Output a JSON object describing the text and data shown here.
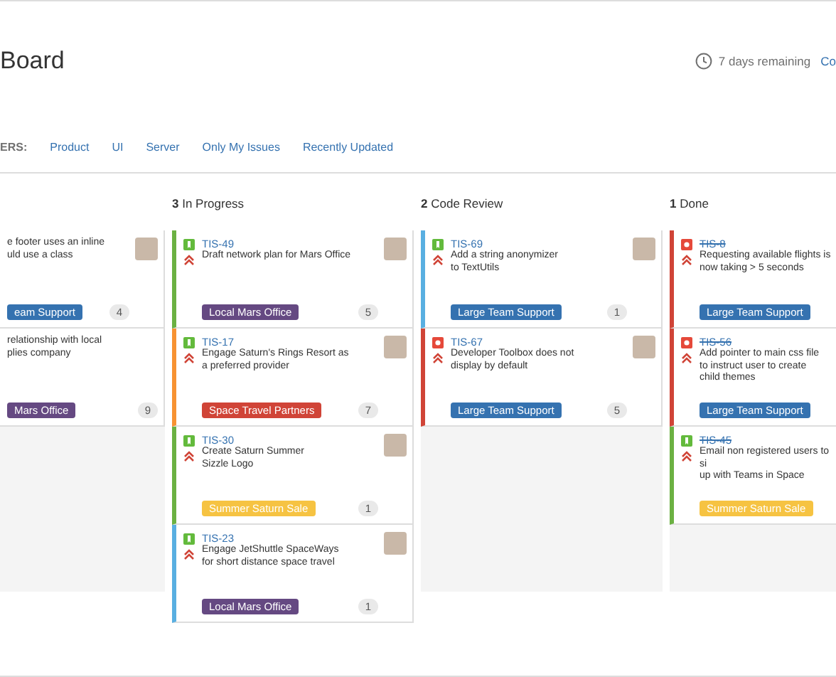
{
  "header": {
    "title": "Board",
    "remaining": "7 days remaining",
    "link": "Co"
  },
  "filters": {
    "label": "ERS:",
    "items": [
      "Product",
      "UI",
      "Server",
      "Only My Issues",
      "Recently Updated"
    ]
  },
  "columns": [
    {
      "cards": [
        {
          "summary": "e footer uses an inline\nuld use a class",
          "epic": {
            "label": "eam Support",
            "color": "#3572b0"
          },
          "count": "4",
          "avatar": true
        },
        {
          "summary": "relationship with local\nplies company",
          "epic": {
            "label": "Mars Office",
            "color": "#654982"
          },
          "count": "9",
          "avatar": false
        }
      ]
    },
    {
      "count": "3",
      "name": "In Progress",
      "cards": [
        {
          "color": "#6bb142",
          "kind": "story",
          "key": "TIS-49",
          "done": false,
          "summary": "Draft network plan for Mars Office",
          "epic": {
            "label": "Local Mars Office",
            "color": "#654982"
          },
          "count": "5",
          "avatar": true
        },
        {
          "color": "#f79232",
          "kind": "story",
          "key": "TIS-17",
          "done": false,
          "summary": "Engage Saturn's Rings Resort as\na preferred provider",
          "epic": {
            "label": "Space Travel Partners",
            "color": "#d04437"
          },
          "count": "7",
          "avatar": true
        },
        {
          "color": "#6bb142",
          "kind": "story",
          "key": "TIS-30",
          "done": false,
          "summary": "Create Saturn Summer\nSizzle Logo",
          "epic": {
            "label": "Summer Saturn Sale",
            "color": "#f6c342"
          },
          "count": "1",
          "avatar": true
        },
        {
          "color": "#59afe1",
          "kind": "story",
          "key": "TIS-23",
          "done": false,
          "summary": "Engage JetShuttle SpaceWays\nfor short distance space travel",
          "epic": {
            "label": "Local Mars Office",
            "color": "#654982"
          },
          "count": "1",
          "avatar": true
        }
      ]
    },
    {
      "count": "2",
      "name": "Code Review",
      "cards": [
        {
          "color": "#59afe1",
          "kind": "story",
          "key": "TIS-69",
          "done": false,
          "summary": "Add a string anonymizer\nto TextUtils",
          "epic": {
            "label": "Large Team Support",
            "color": "#3572b0"
          },
          "count": "1",
          "avatar": true
        },
        {
          "color": "#d04437",
          "kind": "bug",
          "key": "TIS-67",
          "done": false,
          "summary": "Developer Toolbox does not\ndisplay by default",
          "epic": {
            "label": "Large Team Support",
            "color": "#3572b0"
          },
          "count": "5",
          "avatar": true
        }
      ]
    },
    {
      "count": "1",
      "name": "Done",
      "cards": [
        {
          "color": "#d04437",
          "kind": "bug",
          "key": "TIS-8",
          "done": true,
          "summary": "Requesting available flights is\nnow taking > 5 seconds",
          "epic": {
            "label": "Large Team Support",
            "color": "#3572b0"
          },
          "avatar": false
        },
        {
          "color": "#d04437",
          "kind": "bug",
          "key": "TIS-56",
          "done": true,
          "summary": "Add pointer to main css file\nto instruct user to create\nchild themes",
          "epic": {
            "label": "Large Team Support",
            "color": "#3572b0"
          },
          "avatar": false
        },
        {
          "color": "#6bb142",
          "kind": "story",
          "key": "TIS-45",
          "done": true,
          "summary": "Email non registered users to si\nup with Teams in Space",
          "epic": {
            "label": "Summer Saturn Sale",
            "color": "#f6c342"
          },
          "avatar": false
        }
      ]
    }
  ]
}
